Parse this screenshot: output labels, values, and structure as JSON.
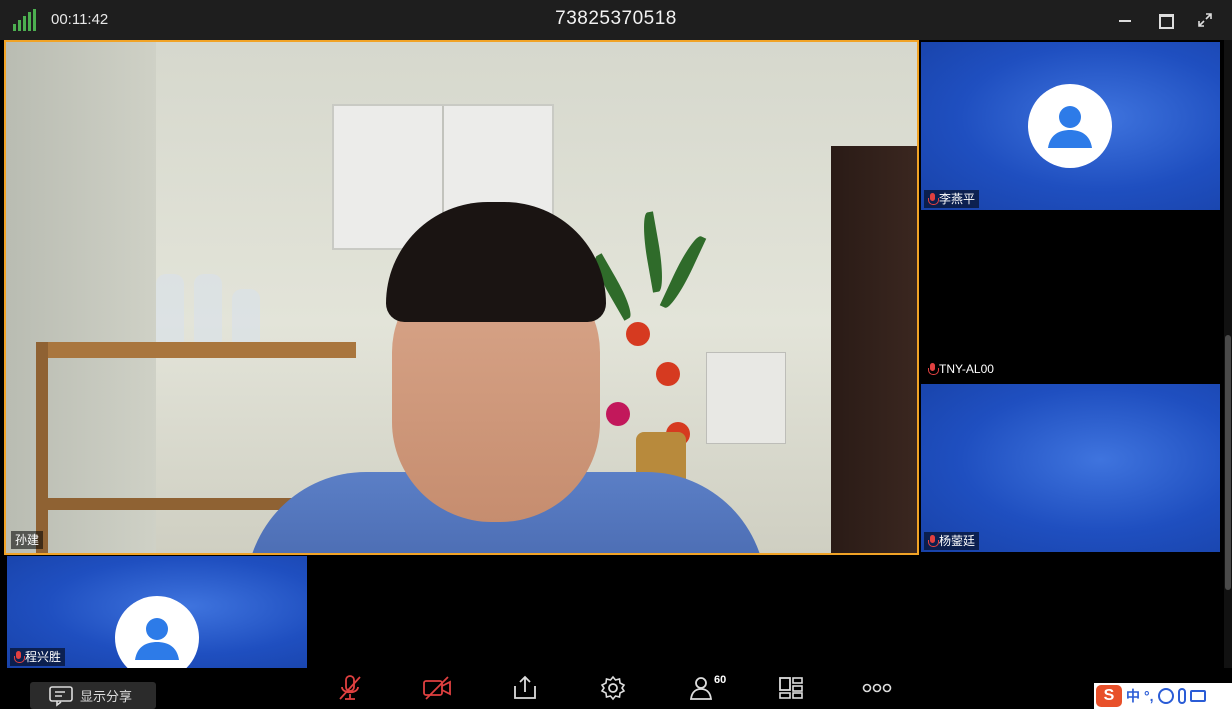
{
  "titlebar": {
    "timer": "00:11:42",
    "meeting_id": "73825370518"
  },
  "main_video": {
    "name": "孙建"
  },
  "participants": [
    {
      "name": "李燕平",
      "video": "avatar"
    },
    {
      "name": "TNY-AL00",
      "video": "off"
    },
    {
      "name": "杨蓥廷",
      "video": "blue"
    },
    {
      "name": "程兴胜",
      "video": "avatar"
    }
  ],
  "toolbar": {
    "share_label": "显示分享",
    "participant_count": "60",
    "icons": [
      "mute-mic-icon",
      "stop-video-icon",
      "share-icon",
      "settings-icon",
      "participants-icon",
      "layout-icon",
      "more-icon"
    ]
  },
  "ime": {
    "logo": "S",
    "mode": "中",
    "punct": "°,"
  },
  "colors": {
    "active_speaker_border": "#f1a326",
    "tile_blue": "#1f4fc0",
    "muted_red": "#e04040",
    "signal_green": "#4caf50"
  }
}
